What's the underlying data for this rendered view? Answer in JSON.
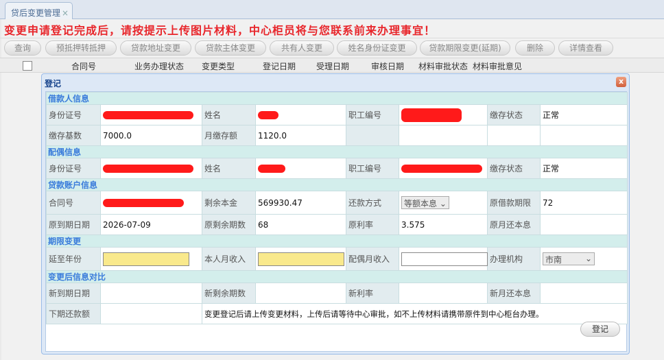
{
  "tab": {
    "label": "贷后变更管理",
    "close": "×"
  },
  "notice": "变更申请登记完成后，请按提示上传图片材料，中心柜员将与您联系前来办理事宜！",
  "toolbar": [
    "查询",
    "预抵押转抵押",
    "贷款地址变更",
    "贷款主体变更",
    "共有人变更",
    "姓名身份证变更",
    "贷款期限变更(延期)",
    "删除",
    "详情查看"
  ],
  "grid_headers": [
    "合同号",
    "业务办理状态",
    "变更类型",
    "登记日期",
    "受理日期",
    "审核日期",
    "材料审批状态",
    "材料审批意见"
  ],
  "dialog": {
    "title": "登记",
    "close": "x",
    "borrower": {
      "section": "借款人信息",
      "id_label": "身份证号",
      "name_label": "姓名",
      "emp_label": "职工编号",
      "status_label": "缴存状态",
      "status": "正常",
      "base_label": "缴存基数",
      "base": "7000.0",
      "monthly_label": "月缴存额",
      "monthly": "1120.0"
    },
    "spouse": {
      "section": "配偶信息",
      "id_label": "身份证号",
      "name_label": "姓名",
      "emp_label": "职工编号",
      "status_label": "缴存状态",
      "status": "正常"
    },
    "account": {
      "section": "贷款账户信息",
      "contract_label": "合同号",
      "remain_label": "剩余本金",
      "remain": "569930.47",
      "method_label": "还款方式",
      "method": "等额本息",
      "term_label": "原借款期限",
      "term": "72",
      "due_label": "原到期日期",
      "due": "2026-07-09",
      "periods_label": "原剩余期数",
      "periods": "68",
      "rate_label": "原利率",
      "rate": "3.575",
      "pay_label": "原月还本息"
    },
    "change": {
      "section": "期限变更",
      "extend_label": "延至年份",
      "income_label": "本人月收入",
      "spouse_income_label": "配偶月收入",
      "org_label": "办理机构",
      "org": "市南"
    },
    "compare": {
      "section": "变更后信息对比",
      "new_due_label": "新到期日期",
      "new_periods_label": "新剩余期数",
      "new_rate_label": "新利率",
      "new_pay_label": "新月还本息",
      "next_label": "下期还款额",
      "warning": "变更登记后请上传变更材料，上传后请等待中心审批，如不上传材料请携带原件到中心柜台办理。"
    },
    "submit": "登记"
  }
}
